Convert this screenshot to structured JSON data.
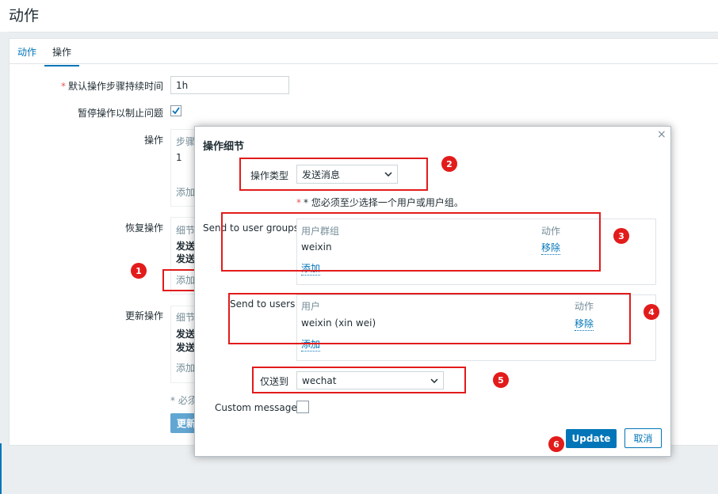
{
  "page_title": "动作",
  "tabs": [
    {
      "label": "动作"
    },
    {
      "label": "操作"
    }
  ],
  "form": {
    "duration_label": "默认操作步骤持续时间",
    "duration_value": "1h",
    "pause_label": "暂停操作以制止问题",
    "operations_label": "操作",
    "operations_col_step": "步骤",
    "operations_step_value": "1",
    "operations_add": "添加",
    "recovery_label": "恢复操作",
    "recovery_col_details": "细节",
    "recovery_row1": "发送",
    "recovery_row2": "发送",
    "recovery_add": "添加",
    "update_label": "更新操作",
    "update_col_details": "细节",
    "update_row1": "发送",
    "update_row2": "发送",
    "update_add": "添加",
    "required_note": "* 必须",
    "update_button": "更新"
  },
  "modal": {
    "title": "操作细节",
    "close": "×",
    "op_type_label": "操作类型",
    "op_type_value": "发送消息",
    "warning": "* 您必须至少选择一个用户或用户组。",
    "groups_label": "Send to user groups",
    "groups_col_name": "用户群组",
    "groups_col_action": "动作",
    "groups": [
      {
        "name": "weixin",
        "action": "移除"
      }
    ],
    "groups_add": "添加",
    "users_label": "Send to users",
    "users_col_name": "用户",
    "users_col_action": "动作",
    "users": [
      {
        "name": "weixin (xin wei)",
        "action": "移除"
      }
    ],
    "users_add": "添加",
    "sendonly_label": "仅送到",
    "sendonly_value": "wechat",
    "custom_message_label": "Custom message",
    "update_button": "Update",
    "cancel_button": "取消"
  },
  "markers": [
    "1",
    "2",
    "3",
    "4",
    "5",
    "6"
  ],
  "colors": {
    "accent": "#0275b8",
    "marker_red": "#e21b1b",
    "required_red": "#e45959"
  }
}
